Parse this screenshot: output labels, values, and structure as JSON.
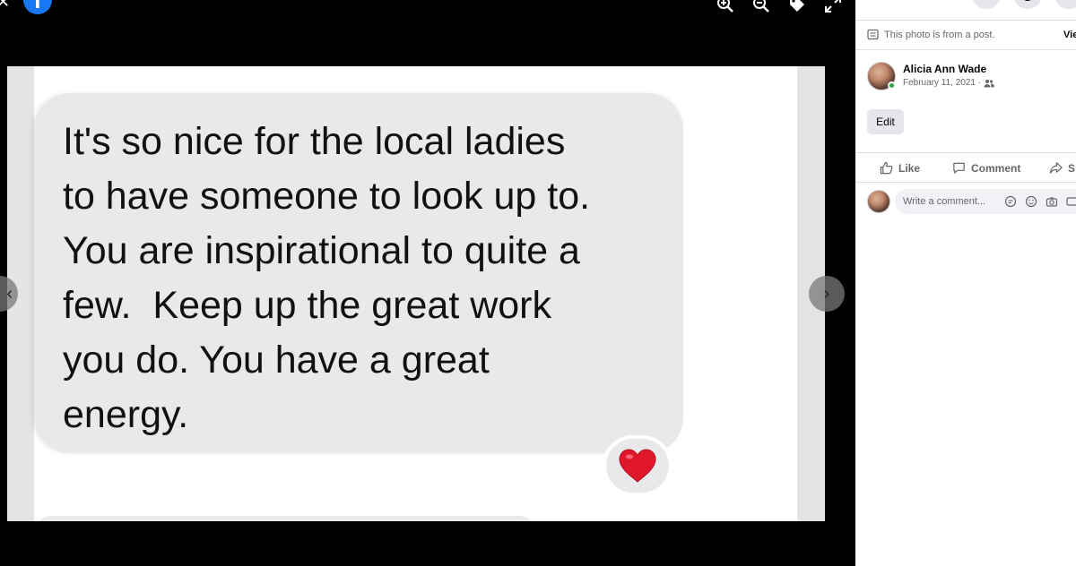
{
  "viewer": {
    "tools": [
      "zoom-in-icon",
      "zoom-out-icon",
      "tag-icon",
      "fullscreen-icon"
    ],
    "nav": {
      "prev": "‹",
      "next": "›"
    }
  },
  "photo": {
    "message_text": "It's so nice for the local ladies\nto have someone to look up to.\nYou are inspirational to quite a\nfew.  Keep up the great work\nyou do. You have a great\nenergy.",
    "reaction": "heart-icon"
  },
  "sidebar": {
    "from_post_text": "This photo is from a post.",
    "view_link": "Vie",
    "author": {
      "name": "Alicia Ann Wade",
      "date": "February 11, 2021 ·",
      "privacy": "friends-icon"
    },
    "edit_label": "Edit",
    "actions": {
      "like": "Like",
      "comment": "Comment",
      "share": "S"
    },
    "comment_placeholder": "Write a comment..."
  },
  "colors": {
    "brand": "#1877f2",
    "bubble": "#e9e9eb",
    "online": "#31a24c",
    "secondary_text": "#65676b"
  }
}
